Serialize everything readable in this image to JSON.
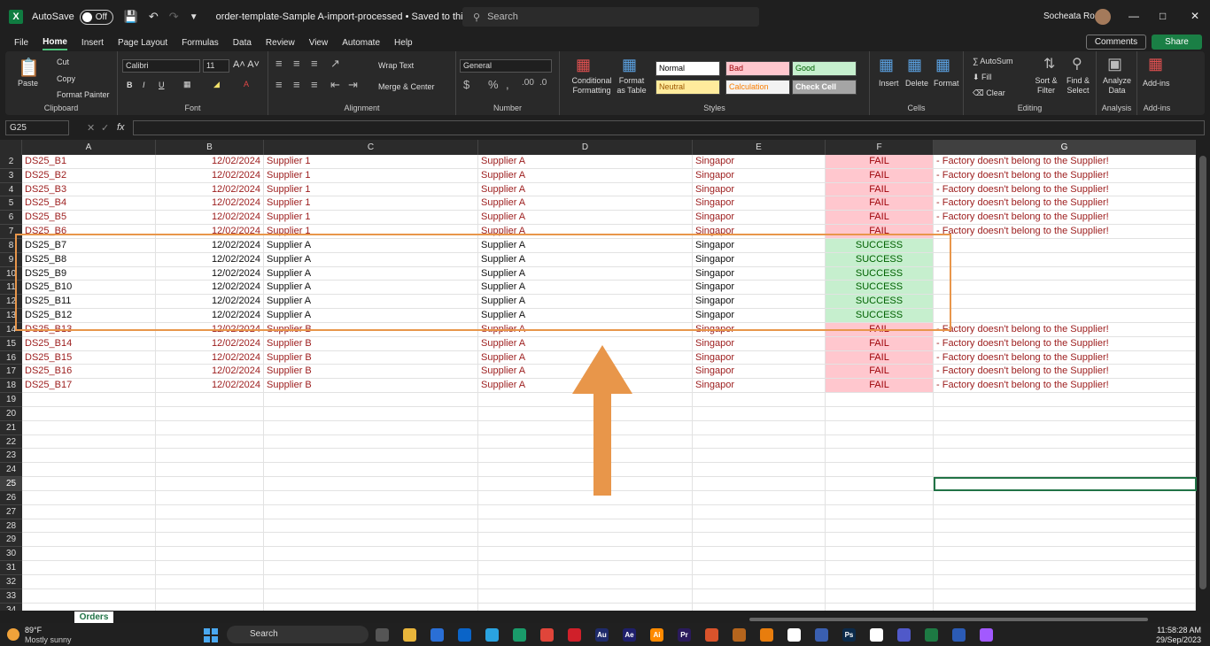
{
  "titlebar": {
    "autosave_label": "AutoSave",
    "autosave_state": "Off",
    "doc_title": "order-template-Sample A-import-processed • Saved to this PC",
    "search_placeholder": "Search",
    "user_name": "Socheata Rou"
  },
  "menu": {
    "tabs": [
      "File",
      "Home",
      "Insert",
      "Page Layout",
      "Formulas",
      "Data",
      "Review",
      "View",
      "Automate",
      "Help"
    ],
    "active": "Home",
    "comments_label": "Comments",
    "share_label": "Share"
  },
  "ribbon": {
    "clipboard": {
      "label": "Clipboard",
      "paste": "Paste",
      "cut": "Cut",
      "copy": "Copy",
      "format_painter": "Format Painter"
    },
    "font": {
      "label": "Font",
      "family": "Calibri",
      "size": "11"
    },
    "alignment": {
      "label": "Alignment",
      "wrap_text": "Wrap Text",
      "merge_center": "Merge & Center"
    },
    "number": {
      "label": "Number",
      "format": "General"
    },
    "styles": {
      "label": "Styles",
      "conditional_formatting": "Conditional Formatting",
      "format_as_table": "Format as Table",
      "cells": [
        "Normal",
        "Bad",
        "Good",
        "Neutral",
        "Calculation",
        "Check Cell"
      ]
    },
    "cells": {
      "label": "Cells",
      "insert": "Insert",
      "delete": "Delete",
      "format": "Format"
    },
    "editing": {
      "label": "Editing",
      "autosum": "AutoSum",
      "fill": "Fill",
      "clear": "Clear",
      "sort_filter": "Sort & Filter",
      "find_select": "Find & Select"
    },
    "analysis": {
      "label": "Analysis",
      "analyze_data": "Analyze Data"
    },
    "addins": {
      "label": "Add-ins",
      "addins": "Add-ins"
    }
  },
  "formula_bar": {
    "name_box": "G25",
    "formula": ""
  },
  "columns": [
    "A",
    "B",
    "C",
    "D",
    "E",
    "F",
    "G"
  ],
  "rows": [
    {
      "num": "2",
      "a": "DS25_B1",
      "b": "12/02/2024",
      "c": "Supplier 1",
      "d": "Supplier A",
      "e": "Singapor",
      "f": "FAIL",
      "g": "- Factory doesn't belong to the Supplier!"
    },
    {
      "num": "3",
      "a": "DS25_B2",
      "b": "12/02/2024",
      "c": "Supplier 1",
      "d": "Supplier A",
      "e": "Singapor",
      "f": "FAIL",
      "g": "- Factory doesn't belong to the Supplier!"
    },
    {
      "num": "4",
      "a": "DS25_B3",
      "b": "12/02/2024",
      "c": "Supplier 1",
      "d": "Supplier A",
      "e": "Singapor",
      "f": "FAIL",
      "g": "- Factory doesn't belong to the Supplier!"
    },
    {
      "num": "5",
      "a": "DS25_B4",
      "b": "12/02/2024",
      "c": "Supplier 1",
      "d": "Supplier A",
      "e": "Singapor",
      "f": "FAIL",
      "g": "- Factory doesn't belong to the Supplier!"
    },
    {
      "num": "6",
      "a": "DS25_B5",
      "b": "12/02/2024",
      "c": "Supplier 1",
      "d": "Supplier A",
      "e": "Singapor",
      "f": "FAIL",
      "g": "- Factory doesn't belong to the Supplier!"
    },
    {
      "num": "7",
      "a": "DS25_B6",
      "b": "12/02/2024",
      "c": "Supplier 1",
      "d": "Supplier A",
      "e": "Singapor",
      "f": "FAIL",
      "g": "- Factory doesn't belong to the Supplier!"
    },
    {
      "num": "8",
      "a": "DS25_B7",
      "b": "12/02/2024",
      "c": "Supplier A",
      "d": "Supplier A",
      "e": "Singapor",
      "f": "SUCCESS",
      "g": ""
    },
    {
      "num": "9",
      "a": "DS25_B8",
      "b": "12/02/2024",
      "c": "Supplier A",
      "d": "Supplier A",
      "e": "Singapor",
      "f": "SUCCESS",
      "g": ""
    },
    {
      "num": "10",
      "a": "DS25_B9",
      "b": "12/02/2024",
      "c": "Supplier A",
      "d": "Supplier A",
      "e": "Singapor",
      "f": "SUCCESS",
      "g": ""
    },
    {
      "num": "11",
      "a": "DS25_B10",
      "b": "12/02/2024",
      "c": "Supplier A",
      "d": "Supplier A",
      "e": "Singapor",
      "f": "SUCCESS",
      "g": ""
    },
    {
      "num": "12",
      "a": "DS25_B11",
      "b": "12/02/2024",
      "c": "Supplier A",
      "d": "Supplier A",
      "e": "Singapor",
      "f": "SUCCESS",
      "g": ""
    },
    {
      "num": "13",
      "a": "DS25_B12",
      "b": "12/02/2024",
      "c": "Supplier A",
      "d": "Supplier A",
      "e": "Singapor",
      "f": "SUCCESS",
      "g": ""
    },
    {
      "num": "14",
      "a": "DS25_B13",
      "b": "12/02/2024",
      "c": "Supplier B",
      "d": "Supplier A",
      "e": "Singapor",
      "f": "FAIL",
      "g": "- Factory doesn't belong to the Supplier!"
    },
    {
      "num": "15",
      "a": "DS25_B14",
      "b": "12/02/2024",
      "c": "Supplier B",
      "d": "Supplier A",
      "e": "Singapor",
      "f": "FAIL",
      "g": "- Factory doesn't belong to the Supplier!"
    },
    {
      "num": "16",
      "a": "DS25_B15",
      "b": "12/02/2024",
      "c": "Supplier B",
      "d": "Supplier A",
      "e": "Singapor",
      "f": "FAIL",
      "g": "- Factory doesn't belong to the Supplier!"
    },
    {
      "num": "17",
      "a": "DS25_B16",
      "b": "12/02/2024",
      "c": "Supplier B",
      "d": "Supplier A",
      "e": "Singapor",
      "f": "FAIL",
      "g": "- Factory doesn't belong to the Supplier!"
    },
    {
      "num": "18",
      "a": "DS25_B17",
      "b": "12/02/2024",
      "c": "Supplier B",
      "d": "Supplier A",
      "e": "Singapor",
      "f": "FAIL",
      "g": "- Factory doesn't belong to the Supplier!"
    }
  ],
  "empty_rows": [
    "19",
    "20",
    "21",
    "22",
    "23",
    "24",
    "25",
    "26",
    "27",
    "28",
    "29",
    "30",
    "31",
    "32",
    "33",
    "34"
  ],
  "selected_row": "25",
  "selected_column": "G",
  "sheet_tab": "Orders",
  "colors": {
    "fail_bg": "#ffc7ce",
    "success_bg": "#c6efce",
    "annotation": "#e8964a",
    "accent": "#217346"
  },
  "taskbar": {
    "weather_temp": "89°F",
    "weather_desc": "Mostly sunny",
    "search_label": "Search",
    "time": "11:58:28 AM",
    "date": "29/Sep/2023",
    "apps": [
      "explorer",
      "file-manager",
      "store",
      "outlook",
      "telegram",
      "edge",
      "chrome",
      "opera",
      "Au",
      "Ae",
      "Ai",
      "Pr",
      "app1",
      "app2",
      "blender",
      "app3",
      "app4",
      "Ps",
      "notion",
      "teams",
      "excel",
      "word",
      "figma"
    ]
  }
}
